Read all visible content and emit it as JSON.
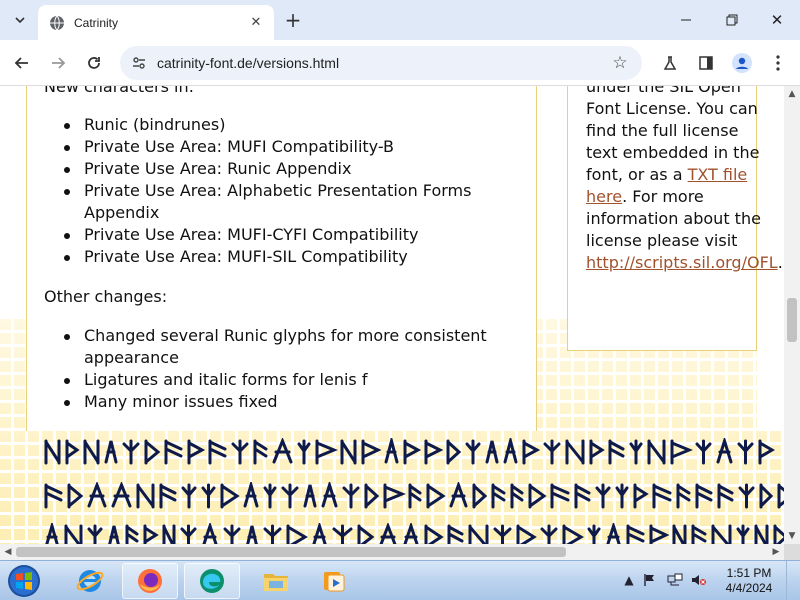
{
  "browser": {
    "tab_title": "Catrinity",
    "url": "catrinity-font.de/versions.html",
    "icons": {
      "tab_search": "chevron-down-icon",
      "favicon": "globe-icon",
      "tab_close": "close-icon",
      "new_tab": "plus-icon",
      "back": "arrow-left-icon",
      "forward": "arrow-right-icon",
      "reload": "reload-icon",
      "site_info": "tune-icon",
      "bookmark": "star-icon",
      "labs": "flask-icon",
      "side_panel": "side-panel-icon",
      "profile": "profile-icon",
      "menu": "kebab-menu-icon"
    }
  },
  "page": {
    "heading_partial": "New characters in:",
    "new_characters": [
      "Runic (bindrunes)",
      "Private Use Area: MUFI Compatibility-B",
      "Private Use Area: Runic Appendix",
      "Private Use Area: Alphabetic Presentation Forms Appendix",
      "Private Use Area: MUFI-CYFI Compatibility",
      "Private Use Area: MUFI-SIL Compatibility"
    ],
    "other_changes_heading": "Other changes:",
    "other_changes": [
      "Changed several Runic glyphs for more consistent appearance",
      "Ligatures and italic forms for lenis f",
      "Many minor issues fixed"
    ],
    "sidebar": {
      "line_partial": "under the SIL Open",
      "text_1": "Font License. You can find the full license text embedded in the font, or as a ",
      "link_1": "TXT file here",
      "text_2": ". For more information about the license please visit ",
      "link_2": "http://scripts.sil.org/OFL",
      "text_3": "."
    },
    "colors": {
      "text": "#111111",
      "link": "#a0522d",
      "box_border": "#e7d27a",
      "pattern": "#fdeaa0",
      "runes": "#0d1a4a"
    }
  },
  "taskbar": {
    "apps": [
      {
        "name": "internet-explorer",
        "icon": "ie-icon"
      },
      {
        "name": "firefox",
        "icon": "firefox-icon"
      },
      {
        "name": "edge",
        "icon": "edge-icon"
      },
      {
        "name": "file-explorer",
        "icon": "folder-icon"
      },
      {
        "name": "media-player",
        "icon": "media-player-icon"
      }
    ],
    "time": "1:51 PM",
    "date": "4/4/2024"
  }
}
